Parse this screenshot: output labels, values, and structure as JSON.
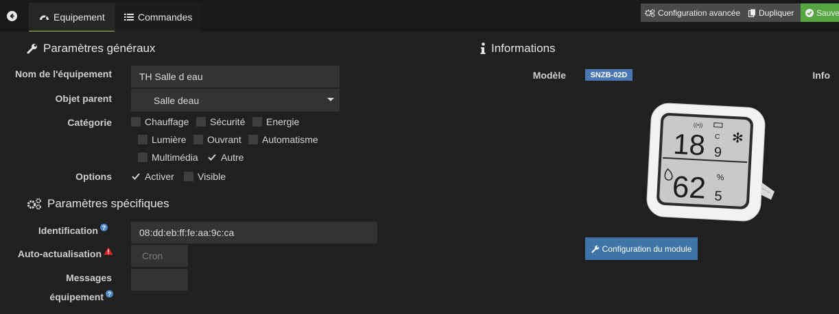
{
  "tabs": {
    "equipment": "Equipement",
    "commands": "Commandes"
  },
  "actions": {
    "advanced_config": "Configuration avancée",
    "duplicate": "Dupliquer",
    "save": "Sauvegarder"
  },
  "general": {
    "title": "Paramètres généraux",
    "name_label": "Nom de l'équipement",
    "name_value": "TH Salle d eau",
    "parent_label": "Objet parent",
    "parent_value": "Salle deau",
    "category_label": "Catégorie",
    "categories": [
      {
        "label": "Chauffage",
        "checked": false
      },
      {
        "label": "Sécurité",
        "checked": false
      },
      {
        "label": "Energie",
        "checked": false
      },
      {
        "label": "Lumière",
        "checked": false
      },
      {
        "label": "Ouvrant",
        "checked": false
      },
      {
        "label": "Automatisme",
        "checked": false
      },
      {
        "label": "Multimédia",
        "checked": false
      },
      {
        "label": "Autre",
        "checked": true
      }
    ],
    "options_label": "Options",
    "options": [
      {
        "label": "Activer",
        "checked": true
      },
      {
        "label": "Visible",
        "checked": false
      }
    ]
  },
  "specific": {
    "title": "Paramètres spécifiques",
    "identification_label": "Identification",
    "identification_value": "08:dd:eb:ff:fe:aa:9c:ca",
    "autorefresh_label": "Auto-actualisation",
    "autorefresh_placeholder": "Cron",
    "messages_label_line1": "Messages",
    "messages_label_line2": "équipement"
  },
  "info": {
    "title": "Informations",
    "model_label": "Modèle",
    "model_value": "SNZB-02D",
    "info_label": "Info",
    "module_button": "Configuration du module",
    "device_display": {
      "temp_main": "18",
      "temp_decimal": "9",
      "temp_unit": "C",
      "hum_main": "62",
      "hum_decimal": "5",
      "hum_unit": "%"
    }
  },
  "colors": {
    "background": "#202020",
    "field": "#333333",
    "accent_green": "#55a642",
    "badge_blue": "#4a77b4",
    "button_blue": "#3f74a8"
  }
}
